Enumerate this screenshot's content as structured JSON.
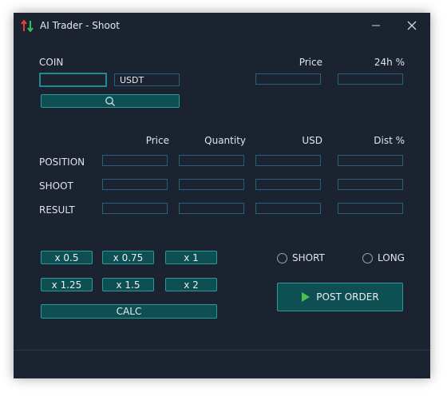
{
  "window": {
    "title": "AI Trader - Shoot"
  },
  "titlebar": {
    "minimize_glyph": "—",
    "close_glyph": "✕"
  },
  "coin": {
    "label": "COIN",
    "input_value": "",
    "quote_value": "USDT",
    "search_icon": "search-icon"
  },
  "market": {
    "price_label": "Price",
    "change_label": "24h %"
  },
  "grid": {
    "headers": {
      "price": "Price",
      "quantity": "Quantity",
      "usd": "USD",
      "dist": "Dist %"
    },
    "rows": {
      "position": "POSITION",
      "shoot": "SHOOT",
      "result": "RESULT"
    }
  },
  "multipliers": {
    "x05": "x 0.5",
    "x075": "x 0.75",
    "x1": "x 1",
    "x125": "x 1.25",
    "x15": "x 1.5",
    "x2": "x 2"
  },
  "calc_label": "CALC",
  "side": {
    "short_label": "SHORT",
    "long_label": "LONG"
  },
  "post_order_label": "POST ORDER",
  "colors": {
    "background": "#1c2330",
    "accent": "#0e4f54",
    "border": "#27607a",
    "arrow_up": "#e04040",
    "arrow_down": "#2fbf5f",
    "play": "#4cc24c"
  }
}
